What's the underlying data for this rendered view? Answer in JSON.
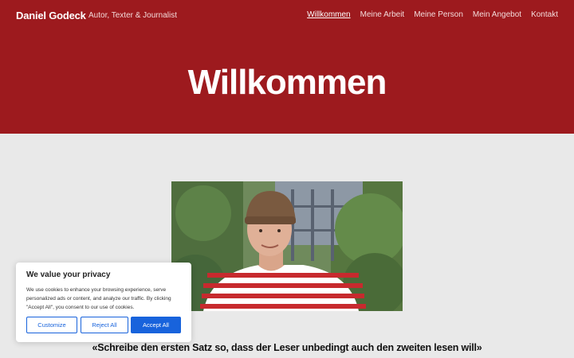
{
  "header": {
    "site_title": "Daniel Godeck",
    "tagline": "Autor, Texter & Journalist",
    "nav": [
      {
        "label": "Willkommen"
      },
      {
        "label": "Meine Arbeit"
      },
      {
        "label": "Meine Person"
      },
      {
        "label": "Mein Angebot"
      },
      {
        "label": "Kontakt"
      }
    ],
    "active_nav": "Willkommen",
    "background_color": "#9d1a1e"
  },
  "hero": {
    "title": "Willkommen"
  },
  "content": {
    "photo_subject": "portrait-photo",
    "quote": "«Schreibe den ersten Satz so, dass der Leser unbedingt auch den zweiten lesen will»"
  },
  "cookie_banner": {
    "title": "We value your privacy",
    "text": "We use cookies to enhance your browsing experience, serve personalized ads or content, and analyze our traffic. By clicking \"Accept All\", you consent to our use of cookies.",
    "customize_label": "Customize",
    "reject_label": "Reject All",
    "accept_label": "Accept All",
    "accent_color": "#1863dc"
  }
}
